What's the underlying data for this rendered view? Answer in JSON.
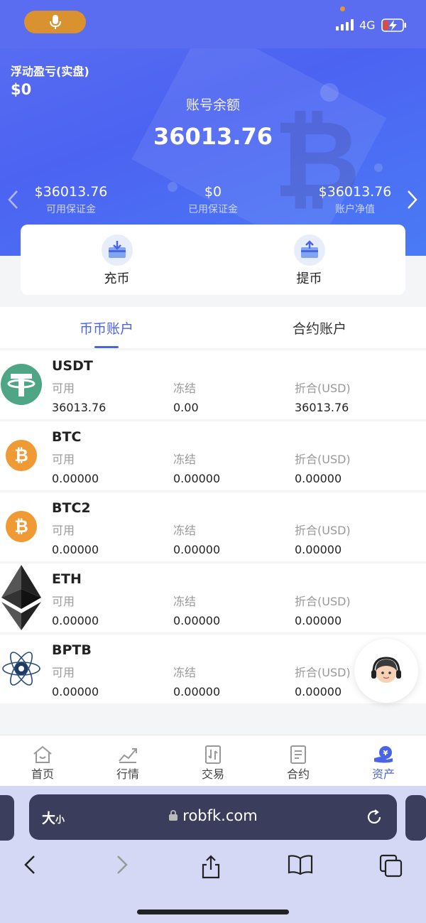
{
  "status_bar": {
    "network": "4G",
    "battery_color": "#e24a3b"
  },
  "header": {
    "floating_pnl_label": "浮动盈亏(实盘)",
    "floating_pnl_value": "$0",
    "balance_label": "账号余额",
    "balance_value": "36013.76",
    "stats": [
      {
        "value": "$36013.76",
        "label": "可用保证金"
      },
      {
        "value": "$0",
        "label": "已用保证金"
      },
      {
        "value": "$36013.76",
        "label": "账户净值"
      }
    ]
  },
  "actions": {
    "deposit": "充币",
    "withdraw": "提币"
  },
  "tabs": [
    {
      "label": "币币账户",
      "active": true
    },
    {
      "label": "合约账户",
      "active": false
    }
  ],
  "columns": {
    "available": "可用",
    "frozen": "冻结",
    "converted": "折合(USD)"
  },
  "assets": [
    {
      "name": "USDT",
      "available": "36013.76",
      "frozen": "0.00",
      "converted": "36013.76",
      "icon": "usdt-icon"
    },
    {
      "name": "BTC",
      "available": "0.00000",
      "frozen": "0.00000",
      "converted": "0.00000",
      "icon": "btc-icon"
    },
    {
      "name": "BTC2",
      "available": "0.00000",
      "frozen": "0.00000",
      "converted": "0.00000",
      "icon": "btc2-icon"
    },
    {
      "name": "ETH",
      "available": "0.00000",
      "frozen": "0.00000",
      "converted": "0.00000",
      "icon": "eth-icon"
    },
    {
      "name": "BPTB",
      "available": "0.00000",
      "frozen": "0.00000",
      "converted": "0.00000",
      "icon": "bptb-icon"
    }
  ],
  "bottom_nav": [
    {
      "label": "首页",
      "icon": "home-icon"
    },
    {
      "label": "行情",
      "icon": "market-icon"
    },
    {
      "label": "交易",
      "icon": "trade-icon"
    },
    {
      "label": "合约",
      "icon": "contract-icon"
    },
    {
      "label": "资产",
      "icon": "assets-icon",
      "active": true
    }
  ],
  "browser": {
    "text_size_big": "大",
    "text_size_small": "小",
    "url": "robfk.com"
  },
  "colors": {
    "accent": "#4a64e8",
    "usdt": "#4fa686",
    "btc": "#f09a35"
  }
}
